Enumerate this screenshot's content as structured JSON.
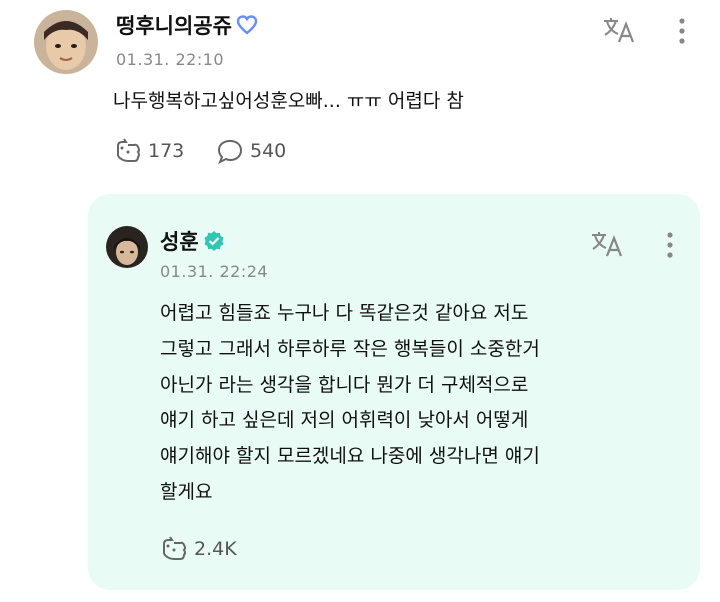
{
  "post": {
    "author": "떵후니의공쥬",
    "timestamp": "01.31. 22:10",
    "text": "나두행복하고싶어성훈오빠... ㅠㅠ 어렵다 참",
    "likes": "173",
    "comments": "540",
    "badge_icon": "heart-outline-icon",
    "accent_color": "#6b8cff"
  },
  "reply": {
    "author": "성훈",
    "timestamp": "01.31. 22:24",
    "lines": [
      "어렵고 힘들죠 누구나 다 똑같은것 같아요 저도",
      "그렇고 그래서 하루하루 작은 행복들이 소중한거",
      "아닌가 라는 생각을 합니다 뭔가 더 구체적으로",
      "얘기 하고 싶은데 저의 어휘력이 낮아서 어떻게",
      "얘기해야 할지 모르겠네요 나중에 생각나면 얘기",
      "할게요"
    ],
    "likes": "2.4K",
    "verified_color": "#2fc6b3",
    "card_color": "#e8fbf5"
  }
}
